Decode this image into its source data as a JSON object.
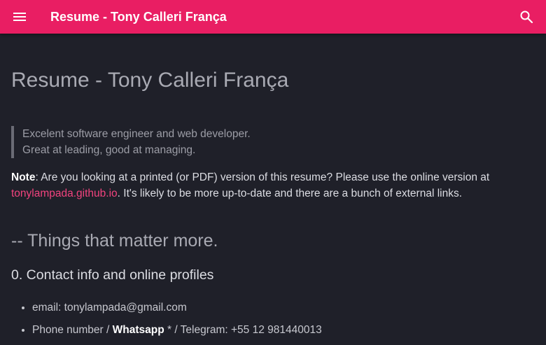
{
  "header": {
    "title": "Resume - Tony Calleri França",
    "menu_icon": "menu-icon",
    "search_icon": "search-icon",
    "accent_color": "#e91e63"
  },
  "main": {
    "title": "Resume - Tony Calleri França",
    "quote": {
      "line1": "Excelent software engineer and web developer.",
      "line2": "Great at leading, good at managing."
    },
    "note": {
      "label": "Note",
      "text1": ": Are you looking at a printed (or PDF) version of this resume? Please use the online version at ",
      "link": "tonylampada.github.io",
      "text2": ". It's likely to be more up-to-date and there are a bunch of external links."
    },
    "section_title": "-- Things that matter more.",
    "subsection_title": "0. Contact info and online profiles",
    "contact": {
      "email": "email: tonylampada@gmail.com",
      "phone_prefix": "Phone number / ",
      "phone_bold": "Whatsapp",
      "phone_suffix": " * / Telegram: +55 12 981440013"
    }
  }
}
